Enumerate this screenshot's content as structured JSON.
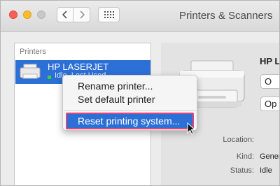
{
  "window": {
    "title": "Printers & Scanners"
  },
  "toolbar": {
    "back_icon": "chevron-left",
    "forward_icon": "chevron-right",
    "show_all_icon": "grid-dots"
  },
  "sidebar": {
    "header": "Printers",
    "printers": [
      {
        "name": "HP LASERJET",
        "status": "Idle, Last Used",
        "selected": true
      }
    ]
  },
  "detail": {
    "name": "HP LA",
    "button1": "O",
    "button2": "Op",
    "fields": [
      {
        "label": "Location:",
        "value": ""
      },
      {
        "label": "Kind:",
        "value": "Gener"
      },
      {
        "label": "Status:",
        "value": "Idle"
      }
    ]
  },
  "context_menu": {
    "items": [
      {
        "label": "Rename printer...",
        "highlighted": false
      },
      {
        "label": "Set default printer",
        "highlighted": false
      },
      {
        "label": "Reset printing system...",
        "highlighted": true
      }
    ]
  },
  "colors": {
    "selection": "#2c6fd6",
    "highlight_border": "#e3447b",
    "status_dot": "#3ad23a"
  }
}
